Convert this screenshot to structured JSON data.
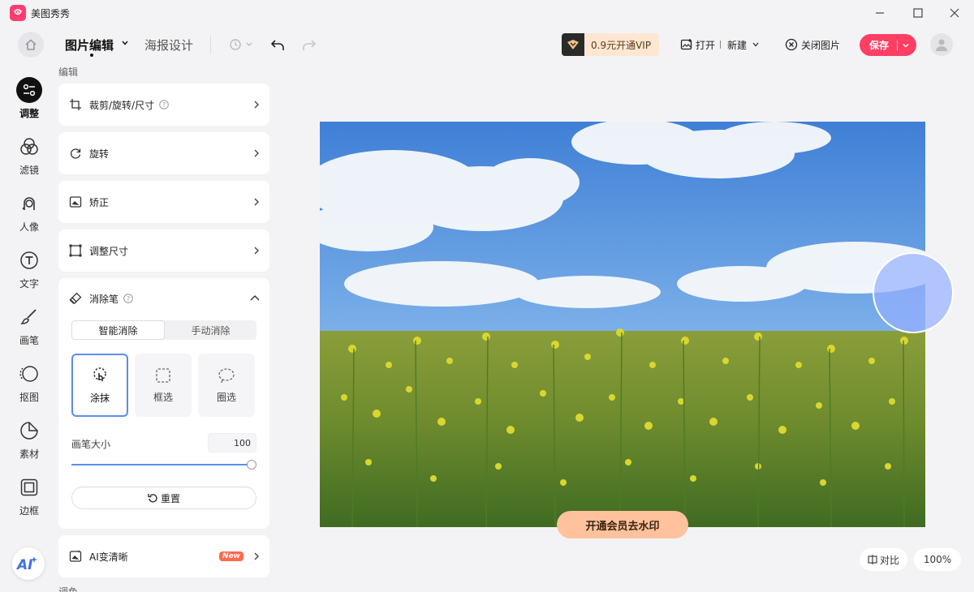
{
  "app": {
    "title": "美图秀秀"
  },
  "tabs": [
    {
      "label": "图片编辑"
    },
    {
      "label": "海报设计"
    }
  ],
  "toolbar": {
    "vip_label": "0.9元开通VIP",
    "open_label": "打开",
    "new_label": "新建",
    "close_image_label": "关闭图片",
    "save_label": "保存"
  },
  "nav": [
    {
      "label": "调整",
      "icon": "adjust-icon",
      "active": true
    },
    {
      "label": "滤镜",
      "icon": "filter-icon"
    },
    {
      "label": "人像",
      "icon": "portrait-icon"
    },
    {
      "label": "文字",
      "icon": "text-icon"
    },
    {
      "label": "画笔",
      "icon": "brush-icon"
    },
    {
      "label": "抠图",
      "icon": "cutout-icon"
    },
    {
      "label": "素材",
      "icon": "sticker-icon"
    },
    {
      "label": "边框",
      "icon": "frame-icon"
    }
  ],
  "panel": {
    "section_edit": "编辑",
    "section_color": "调色",
    "rows": [
      {
        "label": "裁剪/旋转/尺寸",
        "icon": "crop-icon",
        "help": true
      },
      {
        "label": "旋转",
        "icon": "rotate-icon"
      },
      {
        "label": "矫正",
        "icon": "correct-icon"
      },
      {
        "label": "调整尺寸",
        "icon": "resize-icon"
      }
    ],
    "eraser": {
      "title": "消除笔",
      "seg": [
        "智能消除",
        "手动消除"
      ],
      "modes": [
        "涂抹",
        "框选",
        "圈选"
      ],
      "brush_label": "画笔大小",
      "brush_value": "100",
      "brush_level": 1.0,
      "reset_label": "重置"
    },
    "ai_clear": {
      "label": "AI变清晰",
      "badge": "New"
    }
  },
  "canvas": {
    "watermark_button": "开通会员去水印",
    "compare_label": "对比",
    "zoom": "100%"
  },
  "colors": {
    "accent": "#ff3e64",
    "selection": "#5b8def",
    "vip_bg": "#fde7d3"
  }
}
